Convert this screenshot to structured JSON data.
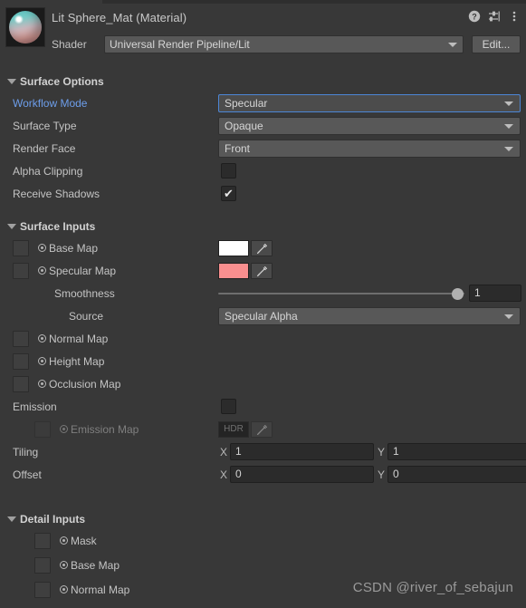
{
  "header": {
    "material_title": "Lit Sphere_Mat (Material)",
    "icons": [
      {
        "name": "help-icon",
        "glyph": "?"
      },
      {
        "name": "preset-icon",
        "glyph": ""
      },
      {
        "name": "more-menu-icon",
        "glyph": "⋮"
      }
    ],
    "shader_label": "Shader",
    "shader_value": "Universal Render Pipeline/Lit",
    "edit_label": "Edit..."
  },
  "surface_options": {
    "title": "Surface Options",
    "workflow_mode": {
      "label": "Workflow Mode",
      "value": "Specular"
    },
    "surface_type": {
      "label": "Surface Type",
      "value": "Opaque"
    },
    "render_face": {
      "label": "Render Face",
      "value": "Front"
    },
    "alpha_clipping": {
      "label": "Alpha Clipping",
      "checked": ""
    },
    "receive_shadows": {
      "label": "Receive Shadows",
      "checked": "✔"
    }
  },
  "surface_inputs": {
    "title": "Surface Inputs",
    "base_map": {
      "label": "Base Map",
      "color": "#ffffff"
    },
    "specular_map": {
      "label": "Specular Map",
      "color": "#fa8f8f"
    },
    "smoothness": {
      "label": "Smoothness",
      "value": "1",
      "percent": 100
    },
    "source": {
      "label": "Source",
      "value": "Specular Alpha"
    },
    "normal_map": {
      "label": "Normal Map"
    },
    "height_map": {
      "label": "Height Map"
    },
    "occlusion_map": {
      "label": "Occlusion Map"
    },
    "emission": {
      "label": "Emission",
      "checked": ""
    },
    "emission_map": {
      "label": "Emission Map",
      "hdr_label": "HDR"
    },
    "tiling": {
      "label": "Tiling",
      "x_axis": "X",
      "x": "1",
      "y_axis": "Y",
      "y": "1"
    },
    "offset": {
      "label": "Offset",
      "x_axis": "X",
      "x": "0",
      "y_axis": "Y",
      "y": "0"
    }
  },
  "detail_inputs": {
    "title": "Detail Inputs",
    "mask": {
      "label": "Mask"
    },
    "base_map": {
      "label": "Base Map"
    },
    "normal_map": {
      "label": "Normal Map"
    }
  },
  "watermark": "CSDN @river_of_sebajun",
  "colors": {
    "accent": "#6d9eeb",
    "panel": "#383838",
    "field": "#2b2b2b",
    "dropdown": "#585858"
  }
}
